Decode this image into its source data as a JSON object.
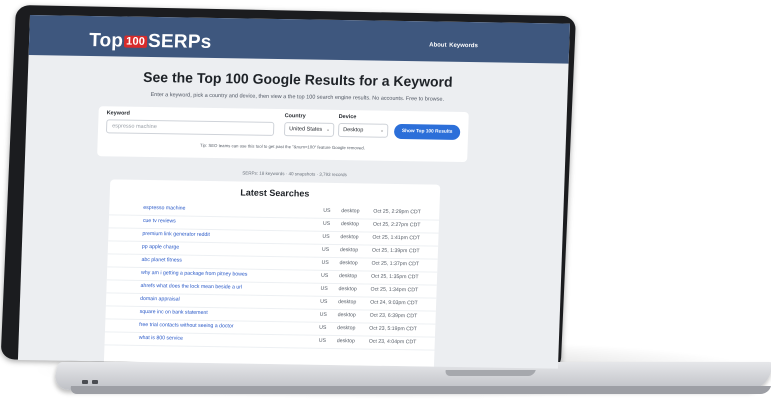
{
  "app": {
    "logo_left": "Top",
    "logo_mid": "100",
    "logo_right": "SERPs",
    "nav": {
      "about": "About",
      "keywords": "Keywords"
    }
  },
  "hero": {
    "title": "See the Top 100 Google Results for a Keyword",
    "subtitle": "Enter a keyword, pick a country and device, then view a the top 100 search engine results. No accounts. Free to browse."
  },
  "search": {
    "keyword_label": "Keyword",
    "keyword_placeholder": "espresso machine",
    "country_label": "Country",
    "country_value": "United States",
    "device_label": "Device",
    "device_value": "Desktop",
    "submit_label": "Show Top 100 Results",
    "tip": "Tip: SEO teams can use this tool to get past the \"&num=100\" feature Google removed."
  },
  "stats": "SERPs: 18 keywords · 40 snapshots · 3,793 records",
  "latest": {
    "title": "Latest Searches",
    "rows": [
      {
        "query": "espresso machine",
        "country": "US",
        "device": "desktop",
        "time": "Oct 25, 2:29pm CDT"
      },
      {
        "query": "cue tv reviews",
        "country": "US",
        "device": "desktop",
        "time": "Oct 25, 2:27pm CDT"
      },
      {
        "query": "premium link generator reddit",
        "country": "US",
        "device": "desktop",
        "time": "Oct 25, 1:41pm CDT"
      },
      {
        "query": "pp apple charge",
        "country": "US",
        "device": "desktop",
        "time": "Oct 25, 1:39pm CDT"
      },
      {
        "query": "abc planet fitness",
        "country": "US",
        "device": "desktop",
        "time": "Oct 25, 1:37pm CDT"
      },
      {
        "query": "why am i getting a package from pitney bowes",
        "country": "US",
        "device": "desktop",
        "time": "Oct 25, 1:35pm CDT"
      },
      {
        "query": "ahrefs what does the lock mean beside a url",
        "country": "US",
        "device": "desktop",
        "time": "Oct 25, 1:34pm CDT"
      },
      {
        "query": "domain appraisal",
        "country": "US",
        "device": "desktop",
        "time": "Oct 24, 9:03pm CDT"
      },
      {
        "query": "square inc on bank statement",
        "country": "US",
        "device": "desktop",
        "time": "Oct 23, 6:39pm CDT"
      },
      {
        "query": "free trial contacts without seeing a doctor",
        "country": "US",
        "device": "desktop",
        "time": "Oct 23, 5:19pm CDT"
      },
      {
        "query": "what is 800 service",
        "country": "US",
        "device": "desktop",
        "time": "Oct 23, 4:04pm CDT"
      }
    ]
  },
  "colors": {
    "header": "#3e577e",
    "accent": "#2c6fd9",
    "logo_badge": "#d92b2b",
    "link": "#2858c7"
  }
}
